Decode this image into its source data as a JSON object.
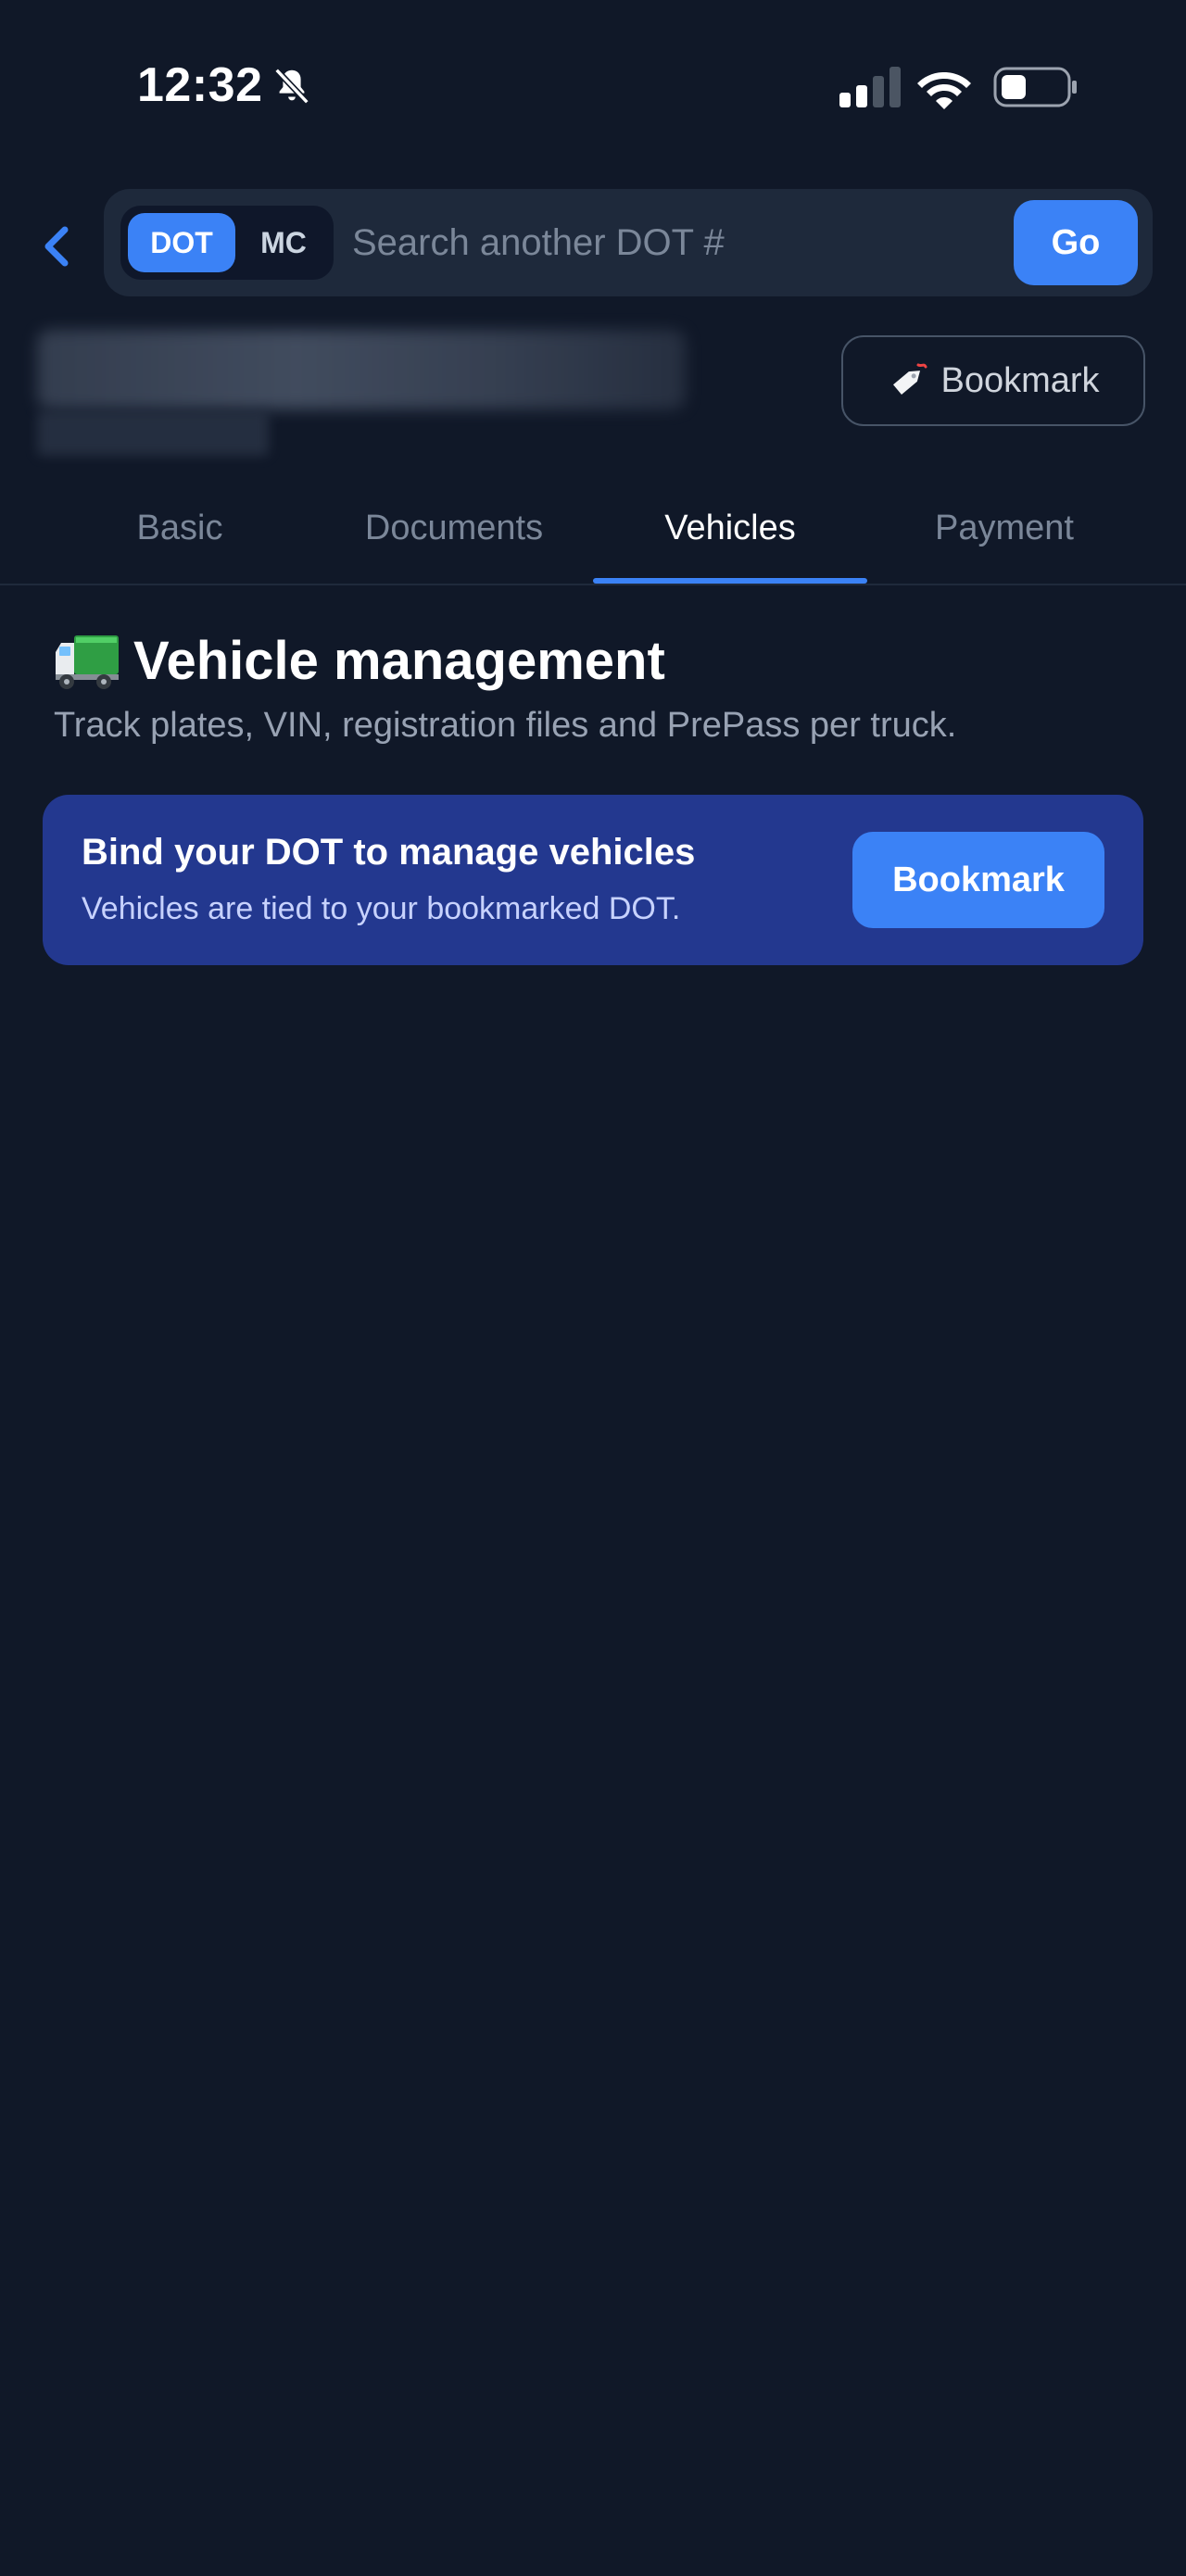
{
  "status_bar": {
    "time": "12:32",
    "icons": [
      "bell-slash-icon",
      "cellular-signal-icon",
      "wifi-icon",
      "battery-icon"
    ]
  },
  "search": {
    "back_icon": "chevron-left-icon",
    "toggle": {
      "options": [
        "DOT",
        "MC"
      ],
      "selected": "DOT"
    },
    "placeholder": "Search another DOT #",
    "value": "",
    "go_label": "Go"
  },
  "header": {
    "bookmark_label": "Bookmark",
    "bookmark_icon": "tag-icon"
  },
  "tabs": [
    {
      "label": "Basic",
      "active": false
    },
    {
      "label": "Documents",
      "active": false
    },
    {
      "label": "Vehicles",
      "active": true
    },
    {
      "label": "Payment",
      "active": false
    }
  ],
  "section": {
    "icon": "truck-icon",
    "title": "Vehicle management",
    "subtitle": "Track plates, VIN, registration files and PrePass per truck."
  },
  "bind_card": {
    "title": "Bind your DOT to manage vehicles",
    "subtitle": "Vehicles are tied to your bookmarked DOT.",
    "button_label": "Bookmark"
  },
  "colors": {
    "background": "#101828",
    "accent": "#3b82f6",
    "card": "#23388f",
    "muted_text": "#7b8799"
  }
}
